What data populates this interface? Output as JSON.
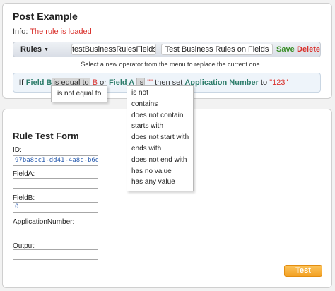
{
  "post": {
    "title": "Post Example",
    "info_label": "Info:",
    "info_message": "The rule is loaded"
  },
  "toolbar": {
    "rules_label": "Rules",
    "rule_name": "testBusinessRulesFields1",
    "rule_description": "Test Business Rules on Fields",
    "save_label": "Save",
    "delete_label": "Delete"
  },
  "hint": "Select a new operator from the menu to replace the current one",
  "rule": {
    "if": "If",
    "field_b": "Field B",
    "op_b": "is equal to",
    "value_b": "B",
    "or": "or",
    "field_a": "Field A",
    "op_a": "is",
    "value_a": "\"\"",
    "then_set": "then set",
    "target_field": "Application Number",
    "to": "to",
    "target_value": "\"123\""
  },
  "dropdown_b": {
    "items": [
      "is not equal to"
    ]
  },
  "dropdown_a": {
    "items": [
      "is not",
      "contains",
      "does not contain",
      "starts with",
      "does not start with",
      "ends with",
      "does not end with",
      "has no value",
      "has any value"
    ]
  },
  "form": {
    "title": "Rule Test Form",
    "id_label": "ID:",
    "id_value": "97ba8bc1-dd41-4a8c-b6e",
    "fielda_label": "FieldA:",
    "fielda_value": "",
    "fieldb_label": "FieldB:",
    "fieldb_value": "0",
    "appnum_label": "ApplicationNumber:",
    "appnum_value": "",
    "output_label": "Output:",
    "output_value": "",
    "test_label": "Test"
  },
  "colors": {
    "save": "#3a8f28",
    "delete": "#d9312c",
    "field": "#2e7d6b",
    "value": "#d9312c",
    "test_button": "#f3a124"
  }
}
